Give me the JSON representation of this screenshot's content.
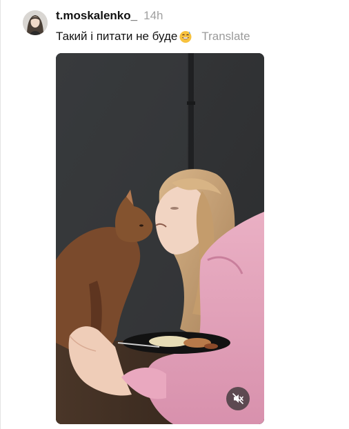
{
  "post": {
    "username": "t.moskalenko_",
    "timestamp": "14h",
    "caption": "Такий і питати не буде",
    "caption_emoji": "smiling-face-with-sweat-emoji",
    "translate_label": "Translate"
  },
  "media": {
    "type": "video",
    "audio_state": "muted",
    "mute_icon": "speaker-muted-icon"
  },
  "colors": {
    "username": "#111111",
    "timestamp": "#a0a0a0",
    "translate": "#9a9a9a",
    "video_background": "#3a3b3c"
  }
}
